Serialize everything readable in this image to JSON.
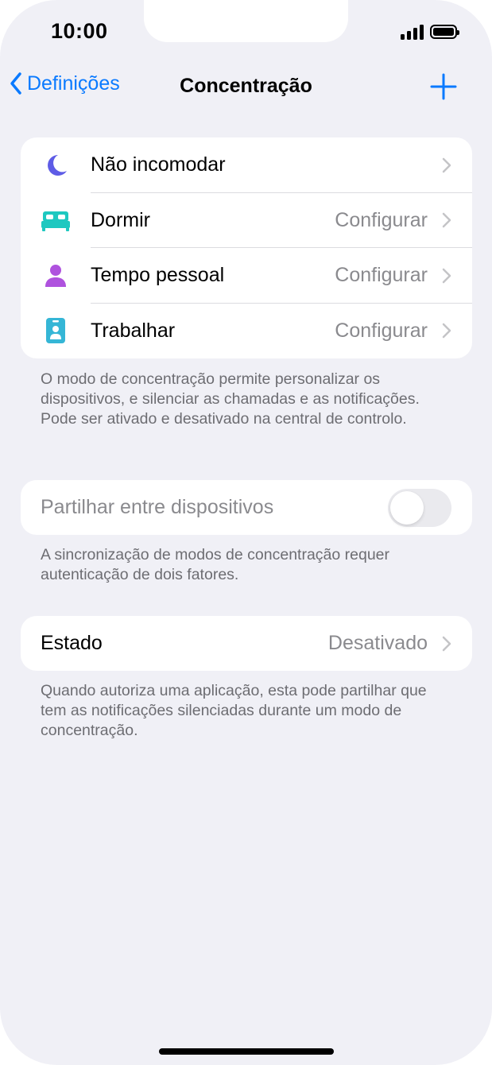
{
  "status_bar": {
    "time": "10:00"
  },
  "nav": {
    "back_label": "Definições",
    "title": "Concentração"
  },
  "focus_modes": [
    {
      "label": "Não incomodar",
      "value": "",
      "icon": "moon-icon",
      "color": "#5E5CE6"
    },
    {
      "label": "Dormir",
      "value": "Configurar",
      "icon": "bed-icon",
      "color": "#1EC8C0"
    },
    {
      "label": "Tempo pessoal",
      "value": "Configurar",
      "icon": "person-icon",
      "color": "#AF52DE"
    },
    {
      "label": "Trabalhar",
      "value": "Configurar",
      "icon": "badge-icon",
      "color": "#35B6D6"
    }
  ],
  "focus_footer": "O modo de concentração permite personalizar os dispositivos, e silenciar as chamadas e as notificações. Pode ser ativado e desativado na central de controlo.",
  "share": {
    "label": "Partilhar entre dispositivos",
    "enabled": false,
    "footer": "A sincronização de modos de concentração requer autenticação de dois fatores."
  },
  "status": {
    "label": "Estado",
    "value": "Desativado",
    "footer": "Quando autoriza uma aplicação, esta pode partilhar que tem as notificações silenciadas durante um modo de concentração."
  },
  "colors": {
    "accent": "#0A7AFF",
    "background": "#F0F0F6",
    "secondary_text": "#8A8A8E",
    "footer_text": "#6D6D72"
  }
}
